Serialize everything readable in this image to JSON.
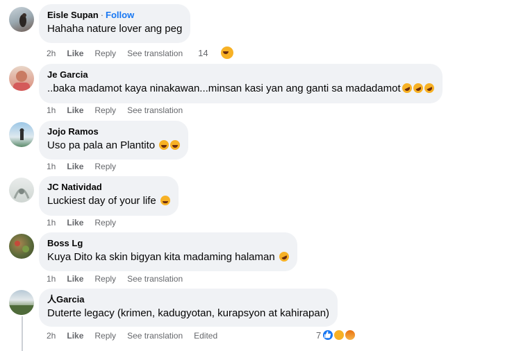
{
  "comments": [
    {
      "name": "Eisle Supan",
      "follow": "Follow",
      "text": "Hahaha nature lover ang peg",
      "time": "2h",
      "like": "Like",
      "reply": "Reply",
      "translate": "See translation",
      "reactions": "14"
    },
    {
      "name": "Je Garcia",
      "text": "..baka madamot kaya ninakawan...minsan kasi yan ang ganti sa madadamot",
      "time": "1h",
      "like": "Like",
      "reply": "Reply",
      "translate": "See translation"
    },
    {
      "name": "Jojo Ramos",
      "text": "Uso pa pala an Plantito",
      "time": "1h",
      "like": "Like",
      "reply": "Reply"
    },
    {
      "name": "JC Natividad",
      "text": "Luckiest day of your life",
      "time": "1h",
      "like": "Like",
      "reply": "Reply"
    },
    {
      "name": "Boss Lg",
      "text": "Kuya Dito ka skin bigyan kita madaming halaman",
      "time": "1h",
      "like": "Like",
      "reply": "Reply",
      "translate": "See translation"
    },
    {
      "name": "人Garcia",
      "text": "Duterte legacy (krimen, kadugyotan, kurapsyon at kahirapan)",
      "time": "2h",
      "like": "Like",
      "reply": "Reply",
      "translate": "See translation",
      "edited": "Edited",
      "reactions": "7"
    }
  ],
  "colors": {
    "bubble": "#f0f2f5",
    "link": "#1877f2",
    "meta": "#65676b",
    "emoji": "#f7b125"
  }
}
